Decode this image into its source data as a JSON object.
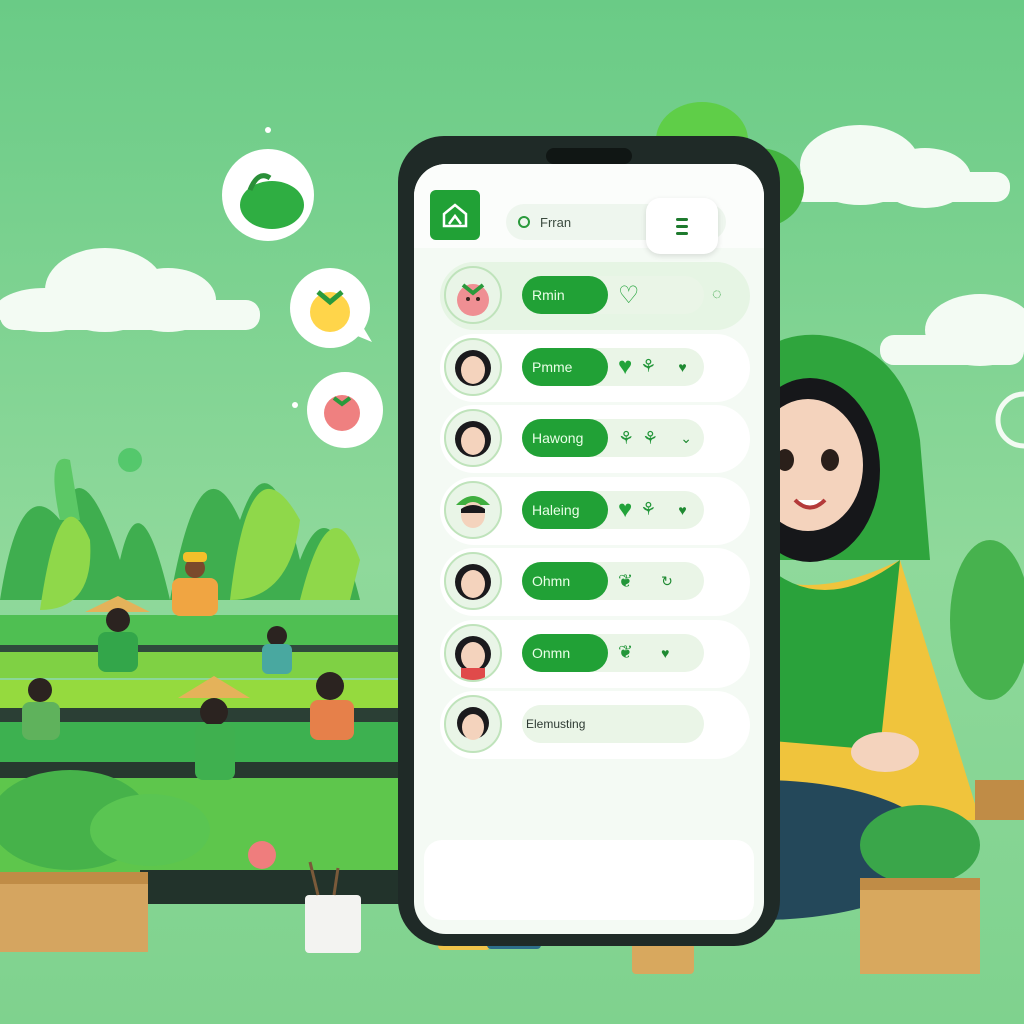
{
  "app": {
    "search_text": "Frran"
  },
  "rows": [
    {
      "label": "Rmin",
      "icons": [
        "heart-outline-icon",
        "chat-icon"
      ]
    },
    {
      "label": "Pmme",
      "icons": [
        "heart-icon",
        "sprout-icon",
        "heart-icon"
      ]
    },
    {
      "label": "Hawong",
      "icons": [
        "sprout-icon",
        "sprout-icon",
        "chevron-icon"
      ]
    },
    {
      "label": "Haleing",
      "icons": [
        "heart-icon",
        "sprout-icon",
        "heart-icon"
      ]
    },
    {
      "label": "Ohmn",
      "icons": [
        "leaf-icon",
        "check-icon"
      ]
    },
    {
      "label": "Onmn",
      "icons": [
        "leaf-icon",
        "heart-icon"
      ]
    },
    {
      "label": "Elemusting",
      "icons": []
    }
  ],
  "colors": {
    "sky": "#6fce8a",
    "accent": "#21a136",
    "phone": "#1f2a27",
    "screen": "#f4faf4"
  }
}
